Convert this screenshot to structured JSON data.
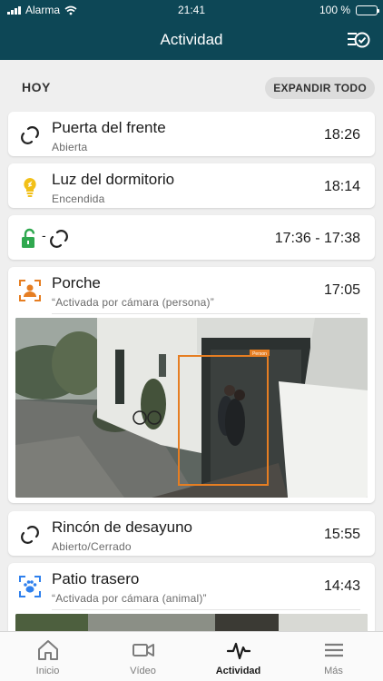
{
  "status_bar": {
    "carrier": "Alarma",
    "time": "21:41",
    "battery": "100 %"
  },
  "header": {
    "title": "Actividad",
    "action_icon": "filter-check-icon"
  },
  "section": {
    "label": "HOY",
    "expand_label": "EXPANDIR TODO"
  },
  "events": [
    {
      "title": "Puerta del frente",
      "subtitle": "Abierta",
      "time": "18:26",
      "icon": "sensor-link-icon"
    },
    {
      "title": "Luz del dormitorio",
      "subtitle": "Encendida",
      "time": "18:14",
      "icon": "light-bulb-icon"
    },
    {
      "title": "",
      "subtitle": "",
      "time": "17:36 - 17:38",
      "icon": "unlock-icon",
      "separator": "-"
    },
    {
      "title": "Porche",
      "subtitle": "“Activada por cámara (persona)”",
      "time": "17:05",
      "icon": "person-camera-icon",
      "detection_label": "Person"
    },
    {
      "title": "Rincón de desayuno",
      "subtitle": "Abierto/Cerrado",
      "time": "15:55",
      "icon": "sensor-link-icon"
    },
    {
      "title": "Patio trasero",
      "subtitle": "“Activada por cámara (animal)”",
      "time": "14:43",
      "icon": "paw-camera-icon"
    }
  ],
  "tabs": [
    {
      "label": "Inicio",
      "icon": "home-icon",
      "active": false
    },
    {
      "label": "Vídeo",
      "icon": "video-camera-icon",
      "active": false
    },
    {
      "label": "Actividad",
      "icon": "activity-pulse-icon",
      "active": true
    },
    {
      "label": "Más",
      "icon": "menu-icon",
      "active": false
    }
  ],
  "colors": {
    "header": "#0d4756",
    "light": "#f2c018",
    "unlock": "#2fa84f",
    "camera_person": "#e67e22",
    "camera_animal": "#2f80ed"
  }
}
